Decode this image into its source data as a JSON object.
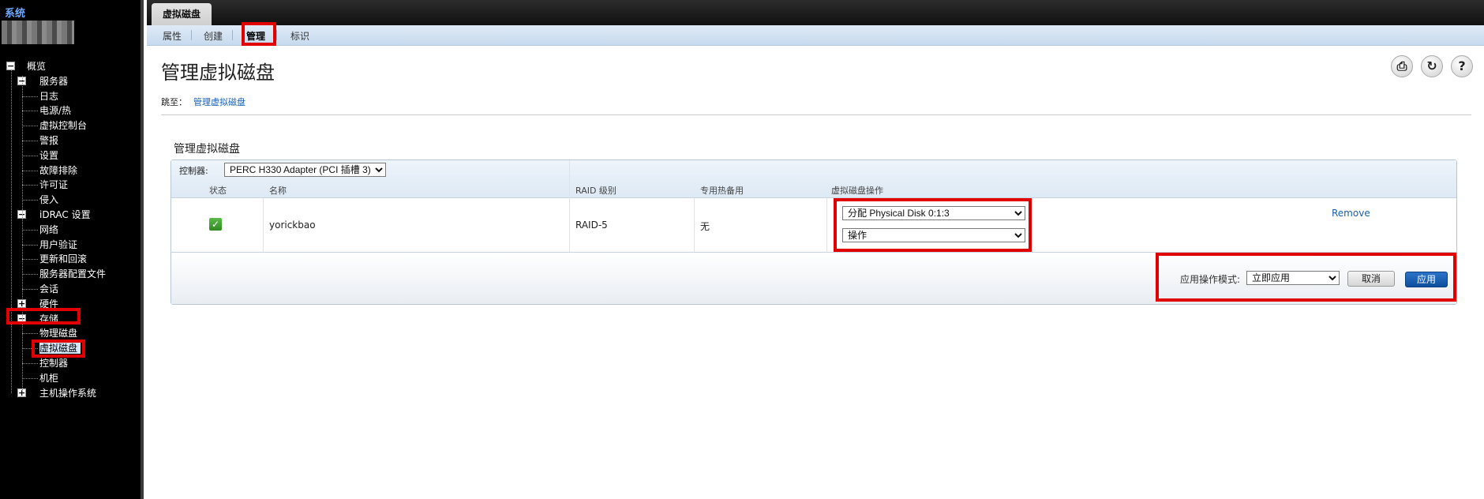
{
  "sidebar": {
    "system_title": "系统",
    "tree": [
      {
        "label": "概览",
        "toggle": "−"
      },
      {
        "label": "服务器",
        "toggle": "−"
      },
      {
        "label": "日志"
      },
      {
        "label": "电源/热"
      },
      {
        "label": "虚拟控制台"
      },
      {
        "label": "警报"
      },
      {
        "label": "设置"
      },
      {
        "label": "故障排除"
      },
      {
        "label": "许可证"
      },
      {
        "label": "侵入"
      },
      {
        "label": "iDRAC 设置",
        "toggle": "−"
      },
      {
        "label": "网络"
      },
      {
        "label": "用户验证"
      },
      {
        "label": "更新和回滚"
      },
      {
        "label": "服务器配置文件"
      },
      {
        "label": "会话"
      },
      {
        "label": "硬件",
        "toggle": "+"
      },
      {
        "label": "存储",
        "toggle": "−"
      },
      {
        "label": "物理磁盘"
      },
      {
        "label": "虚拟磁盘",
        "selected": true
      },
      {
        "label": "控制器"
      },
      {
        "label": "机柜"
      },
      {
        "label": "主机操作系统",
        "toggle": "+"
      }
    ]
  },
  "tabbar": {
    "active_tab": "虚拟磁盘"
  },
  "subnav": {
    "items": [
      "属性",
      "创建",
      "管理",
      "标识"
    ],
    "active": "管理"
  },
  "page": {
    "title": "管理虚拟磁盘",
    "jump_label": "跳至：",
    "jump_link": "管理虚拟磁盘",
    "toolbar_icons": [
      "print-icon",
      "refresh-icon",
      "help-icon"
    ]
  },
  "section": {
    "title": "管理虚拟磁盘",
    "controller_label": "控制器:",
    "controller_value": "PERC H330 Adapter (PCI 插槽 3)",
    "columns": [
      "状态",
      "名称",
      "RAID 级别",
      "专用热备用",
      "虚拟磁盘操作"
    ],
    "rows": [
      {
        "status": "ok",
        "name": "yorickbao",
        "raid": "RAID-5",
        "hotspare": "无",
        "op1": "分配 Physical Disk 0:1:3",
        "op2": "操作",
        "link": "Remove"
      }
    ],
    "apply_mode_label": "应用操作模式:",
    "apply_mode_value": "立即应用",
    "cancel_label": "取消",
    "apply_label": "应用"
  },
  "colors": {
    "highlight": "#e10000",
    "accent": "#1a5fb4"
  }
}
